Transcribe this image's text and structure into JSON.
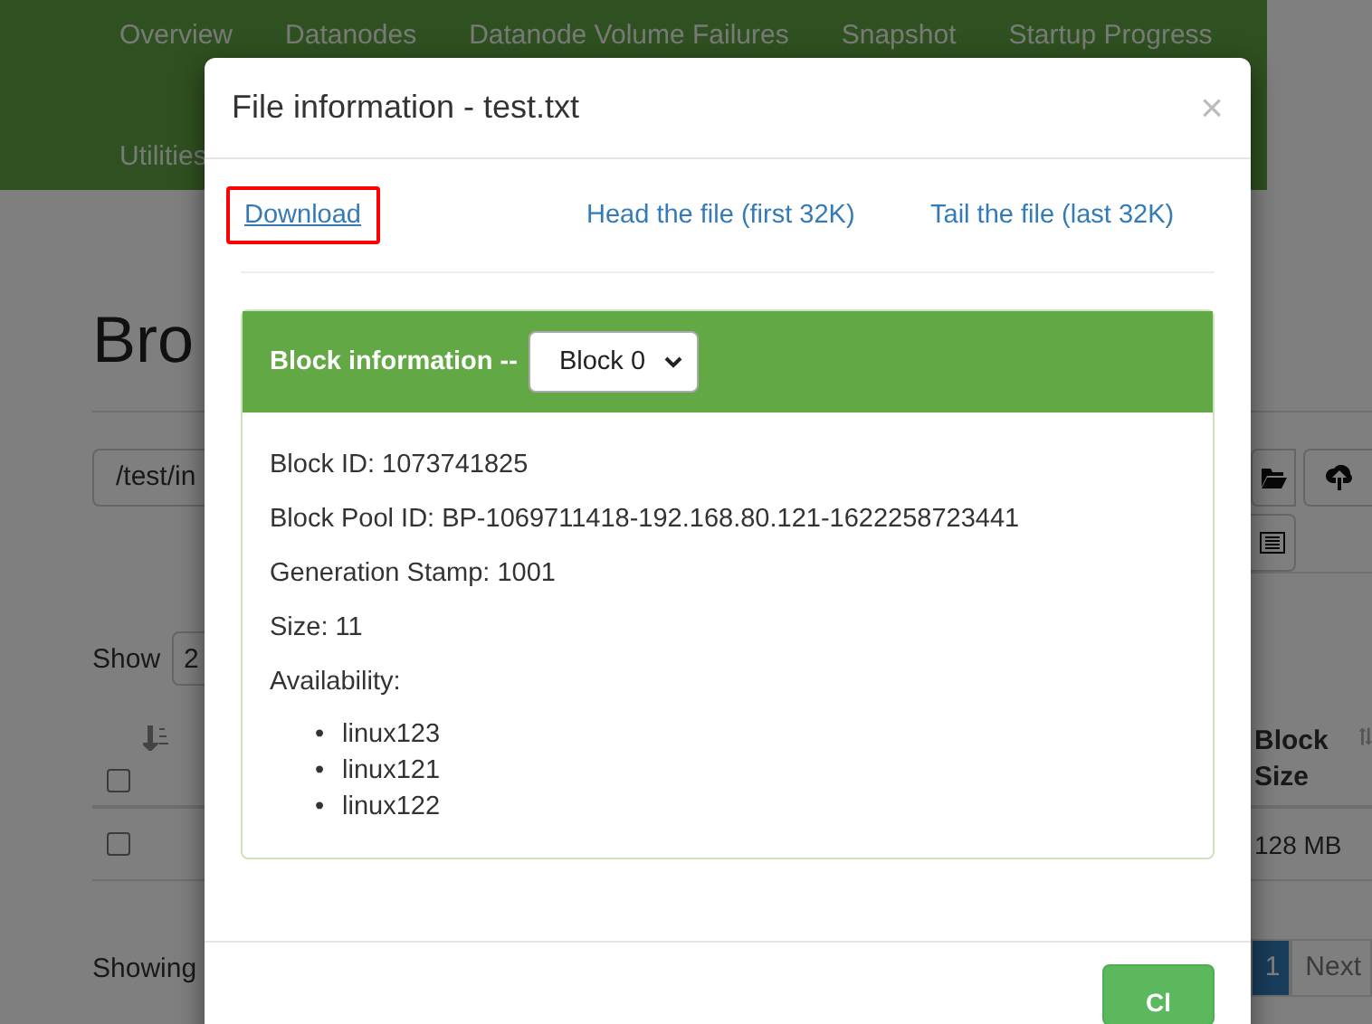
{
  "navbar": {
    "items": [
      {
        "label": "Overview"
      },
      {
        "label": "Datanodes"
      },
      {
        "label": "Datanode Volume Failures"
      },
      {
        "label": "Snapshot"
      },
      {
        "label": "Startup Progress"
      },
      {
        "label": "Utilities"
      }
    ]
  },
  "page": {
    "heading": "Bro",
    "path_value": "/test/in",
    "show_label": "Show",
    "show_value": "2",
    "table": {
      "column_last": "Block Size",
      "row_value": "128 MB",
      "checked": false,
      "row_checked": false
    },
    "showing": "Showing",
    "pagination": [
      {
        "label": "1",
        "selected": true
      },
      {
        "label": "Next",
        "selected": false
      }
    ]
  },
  "modal": {
    "title": "File information - test.txt",
    "close": "×",
    "links": [
      {
        "label": "Download",
        "highlighted": true
      },
      {
        "label": "Head the file (first 32K)",
        "highlighted": false
      },
      {
        "label": "Tail the file (last 32K)",
        "highlighted": false
      }
    ],
    "panel": {
      "heading": "Block information --",
      "select_value": "Block 0",
      "lines": [
        "Block ID: 1073741825",
        "Block Pool ID: BP-1069711418-192.168.80.121-1622258723441",
        "Generation Stamp: 1001",
        "Size: 11",
        "Availability:"
      ],
      "bullet": "•",
      "hosts": [
        "linux123",
        "linux121",
        "linux122"
      ]
    },
    "footer_button": "Cl"
  }
}
